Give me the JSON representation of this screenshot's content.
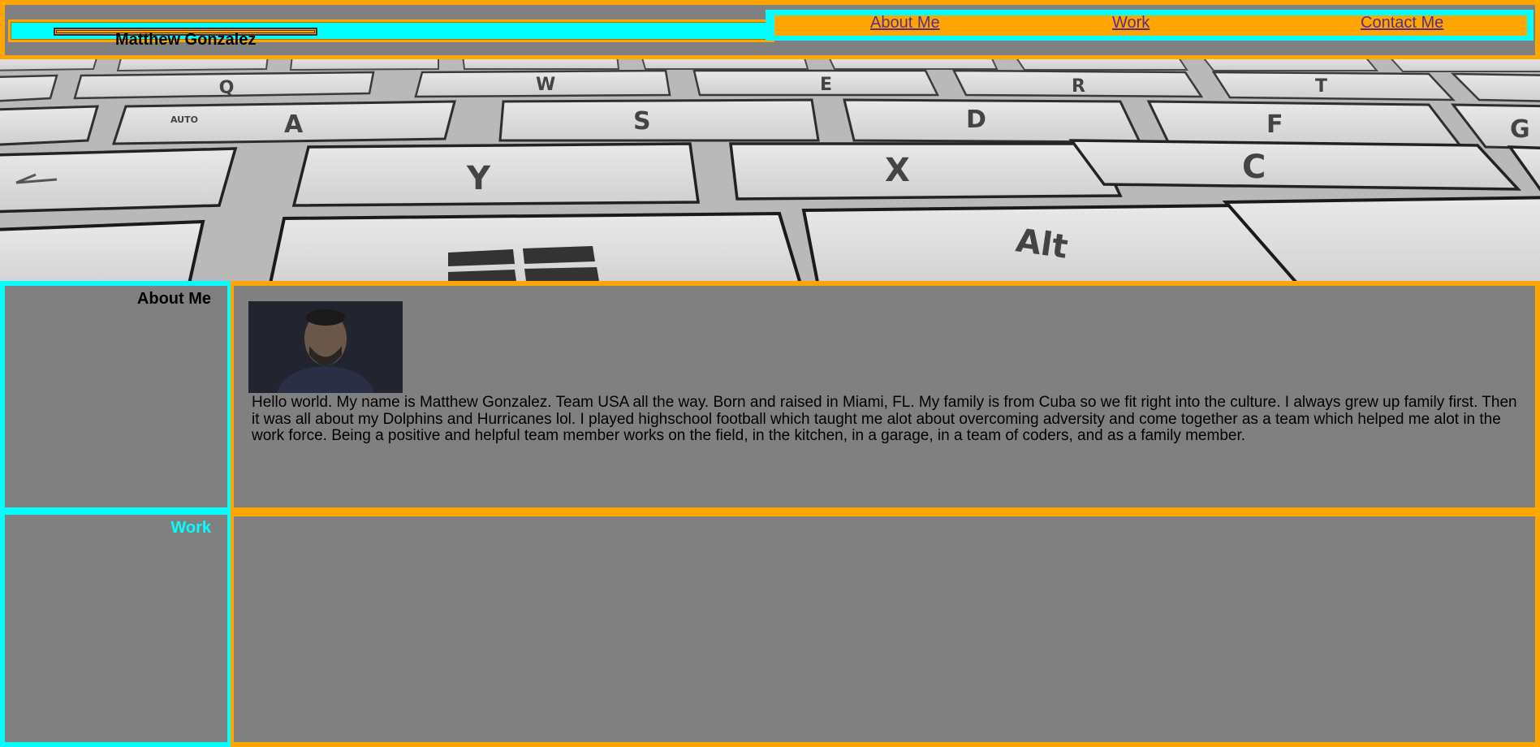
{
  "header": {
    "name": "Matthew Gonzalez",
    "nav": [
      {
        "label": "About Me"
      },
      {
        "label": "Work"
      },
      {
        "label": "Contact Me"
      }
    ]
  },
  "hero": {
    "keys": [
      "Q",
      "W",
      "E",
      "R",
      "T",
      "A",
      "S",
      "D",
      "F",
      "G",
      "Y",
      "X",
      "C",
      "Alt",
      "AUTO"
    ]
  },
  "about": {
    "title": "About Me",
    "bio": "Hello world. My name is Matthew Gonzalez. Team USA all the way. Born and raised in Miami, FL. My family is from Cuba so we fit right into the culture. I always grew up family first. Then it was all about my Dolphins and Hurricanes lol. I played highschool football which taught me alot about overcoming adversity and come together as a team which helped me alot in the work force. Being a positive and helpful team member works on the field, in the kitchen, in a garage, in a team of coders, and as a family member."
  },
  "work": {
    "title": "Work"
  },
  "colors": {
    "accent_orange": "#FFA500",
    "accent_cyan": "#00FFFF",
    "background_gray": "#808080"
  }
}
